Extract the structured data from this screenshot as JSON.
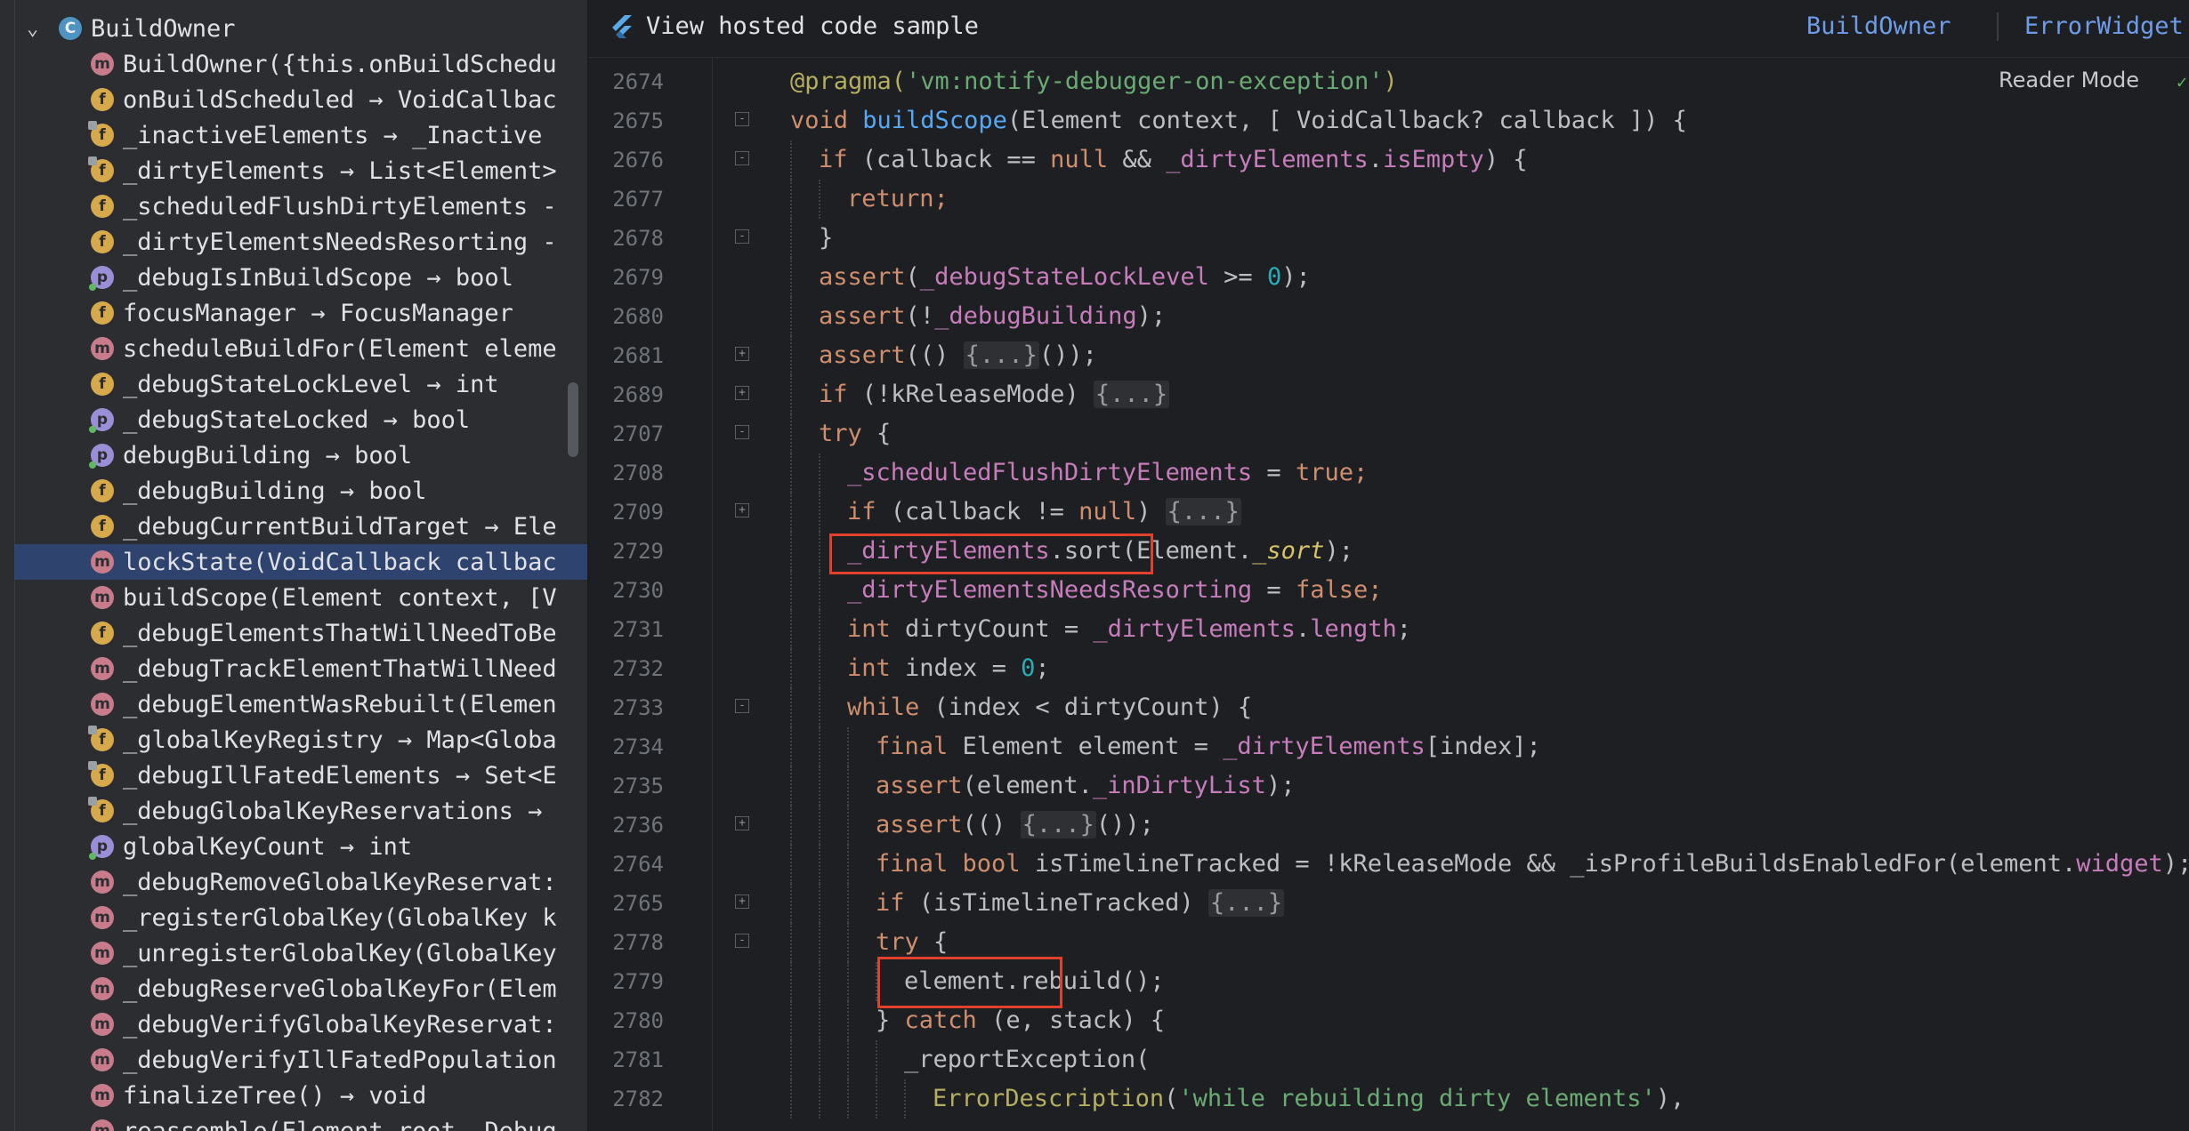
{
  "structure": {
    "root": {
      "label": "BuildOwner",
      "badge": "c"
    },
    "items": [
      {
        "label": "BuildOwner({this.onBuildSchedu",
        "badge": "m",
        "mod": ""
      },
      {
        "label": "onBuildScheduled → VoidCallbac",
        "badge": "f",
        "mod": ""
      },
      {
        "label": "_inactiveElements → _Inactive",
        "badge": "f",
        "mod": "lock"
      },
      {
        "label": "_dirtyElements → List<Element>",
        "badge": "f",
        "mod": "lock"
      },
      {
        "label": "_scheduledFlushDirtyElements -",
        "badge": "f",
        "mod": ""
      },
      {
        "label": "_dirtyElementsNeedsResorting -",
        "badge": "f",
        "mod": ""
      },
      {
        "label": "_debugIsInBuildScope → bool",
        "badge": "p",
        "mod": "pub"
      },
      {
        "label": "focusManager → FocusManager",
        "badge": "f",
        "mod": ""
      },
      {
        "label": "scheduleBuildFor(Element eleme",
        "badge": "m",
        "mod": ""
      },
      {
        "label": "_debugStateLockLevel → int",
        "badge": "f",
        "mod": ""
      },
      {
        "label": "_debugStateLocked → bool",
        "badge": "p",
        "mod": "pub"
      },
      {
        "label": "debugBuilding → bool",
        "badge": "p",
        "mod": "pub"
      },
      {
        "label": "_debugBuilding → bool",
        "badge": "f",
        "mod": ""
      },
      {
        "label": "_debugCurrentBuildTarget → Ele",
        "badge": "f",
        "mod": ""
      },
      {
        "label": "lockState(VoidCallback callbac",
        "badge": "m",
        "mod": "",
        "selected": true
      },
      {
        "label": "buildScope(Element context, [V",
        "badge": "m",
        "mod": ""
      },
      {
        "label": "_debugElementsThatWillNeedToBe",
        "badge": "f",
        "mod": ""
      },
      {
        "label": "_debugTrackElementThatWillNeed",
        "badge": "m",
        "mod": ""
      },
      {
        "label": "_debugElementWasRebuilt(Elemen",
        "badge": "m",
        "mod": ""
      },
      {
        "label": "_globalKeyRegistry → Map<Globa",
        "badge": "f",
        "mod": "lock"
      },
      {
        "label": "_debugIllFatedElements → Set<E",
        "badge": "f",
        "mod": "lock"
      },
      {
        "label": "_debugGlobalKeyReservations →",
        "badge": "f",
        "mod": "lock"
      },
      {
        "label": "globalKeyCount → int",
        "badge": "p",
        "mod": "pub"
      },
      {
        "label": "_debugRemoveGlobalKeyReservat:",
        "badge": "m",
        "mod": ""
      },
      {
        "label": "_registerGlobalKey(GlobalKey k",
        "badge": "m",
        "mod": ""
      },
      {
        "label": "_unregisterGlobalKey(GlobalKey",
        "badge": "m",
        "mod": ""
      },
      {
        "label": "_debugReserveGlobalKeyFor(Elem",
        "badge": "m",
        "mod": ""
      },
      {
        "label": "_debugVerifyGlobalKeyReservat:",
        "badge": "m",
        "mod": ""
      },
      {
        "label": "_debugVerifyIllFatedPopulation",
        "badge": "m",
        "mod": ""
      },
      {
        "label": "finalizeTree() → void",
        "badge": "m",
        "mod": ""
      },
      {
        "label": "reassemble(Element root, Debug",
        "badge": "m",
        "mod": ""
      }
    ]
  },
  "editor": {
    "hosted_link": "View hosted code sample",
    "breadcrumb": [
      "BuildOwner",
      "ErrorWidget"
    ],
    "reader_mode": "Reader Mode",
    "lines": [
      {
        "n": "2674",
        "indent": 1,
        "fold": "",
        "html": "<span class='ann'>@pragma(</span><span class='str'>'vm:notify-debugger-on-exception'</span><span class='ann'>)</span>"
      },
      {
        "n": "2675",
        "indent": 1,
        "fold": "-",
        "html": "<span class='kw'>void </span><span class='fn'>buildScope</span>(Element context, [ VoidCallback? callback ]) {"
      },
      {
        "n": "2676",
        "indent": 2,
        "fold": "-",
        "html": "<span class='kw'>if </span>(callback == <span class='kw'>null</span> &amp;&amp; <span class='fld'>_dirtyElements</span>.<span class='fld'>isEmpty</span>) {"
      },
      {
        "n": "2677",
        "indent": 3,
        "fold": "",
        "html": "<span class='kw'>return;</span>"
      },
      {
        "n": "2678",
        "indent": 2,
        "fold": "-",
        "html": "}"
      },
      {
        "n": "2679",
        "indent": 2,
        "fold": "",
        "html": "<span class='kw'>assert</span>(<span class='fld'>_debugStateLockLevel</span> &gt;= <span class='num'>0</span>);"
      },
      {
        "n": "2680",
        "indent": 2,
        "fold": "",
        "html": "<span class='kw'>assert</span>(!<span class='fld'>_debugBuilding</span>);"
      },
      {
        "n": "2681",
        "indent": 2,
        "fold": "+",
        "html": "<span class='kw'>assert</span>(() <span class='fold-text'>{...}</span>());"
      },
      {
        "n": "2689",
        "indent": 2,
        "fold": "+",
        "html": "<span class='kw'>if </span>(!kReleaseMode) <span class='fold-text'>{...}</span>"
      },
      {
        "n": "2707",
        "indent": 2,
        "fold": "-",
        "html": "<span class='kw'>try </span>{"
      },
      {
        "n": "2708",
        "indent": 3,
        "fold": "",
        "html": "<span class='fld'>_scheduledFlushDirtyElements</span> = <span class='kw'>true;</span>"
      },
      {
        "n": "2709",
        "indent": 3,
        "fold": "+",
        "html": "<span class='kw'>if </span>(callback != <span class='kw'>null</span>) <span class='fold-text'>{...}</span>"
      },
      {
        "n": "2729",
        "indent": 3,
        "fold": "",
        "html": "<span class='fld'>_dirtyElements</span>.sort(Element.<span class='it2'>_sort</span>);"
      },
      {
        "n": "2730",
        "indent": 3,
        "fold": "",
        "html": "<span class='fld'>_dirtyElementsNeedsResorting</span> = <span class='kw'>false;</span>"
      },
      {
        "n": "2731",
        "indent": 3,
        "fold": "",
        "html": "<span class='kw'>int </span>dirtyCount = <span class='fld'>_dirtyElements</span>.<span class='fld'>length</span>;"
      },
      {
        "n": "2732",
        "indent": 3,
        "fold": "",
        "html": "<span class='kw'>int </span>index = <span class='num'>0</span>;"
      },
      {
        "n": "2733",
        "indent": 3,
        "fold": "-",
        "html": "<span class='kw'>while </span>(index &lt; dirtyCount) {"
      },
      {
        "n": "2734",
        "indent": 4,
        "fold": "",
        "html": "<span class='kw'>final </span>Element element = <span class='fld'>_dirtyElements</span>[index];"
      },
      {
        "n": "2735",
        "indent": 4,
        "fold": "",
        "html": "<span class='kw'>assert</span>(element.<span class='fld'>_inDirtyList</span>);"
      },
      {
        "n": "2736",
        "indent": 4,
        "fold": "+",
        "html": "<span class='kw'>assert</span>(() <span class='fold-text'>{...}</span>());"
      },
      {
        "n": "2764",
        "indent": 4,
        "fold": "",
        "html": "<span class='kw'>final </span><span class='kw'>bool </span>isTimelineTracked = !kReleaseMode &amp;&amp; _isProfileBuildsEnabledFor(element.<span class='fld'>widget</span>);"
      },
      {
        "n": "2765",
        "indent": 4,
        "fold": "+",
        "html": "<span class='kw'>if </span>(isTimelineTracked) <span class='fold-text'>{...}</span>"
      },
      {
        "n": "2778",
        "indent": 4,
        "fold": "-",
        "html": "<span class='kw'>try </span>{"
      },
      {
        "n": "2779",
        "indent": 5,
        "fold": "",
        "html": "element.rebuild();"
      },
      {
        "n": "2780",
        "indent": 4,
        "fold": "",
        "html": "} <span class='kw'>catch </span>(e, stack) {"
      },
      {
        "n": "2781",
        "indent": 5,
        "fold": "",
        "html": "_reportException("
      },
      {
        "n": "2782",
        "indent": 6,
        "fold": "",
        "html": "<span class='ann'>ErrorDescription</span>(<span class='str'>'while rebuilding dirty elements'</span>),"
      }
    ]
  },
  "colors": {
    "accent": "#6e9ce8",
    "highlight_box": "#e0412c",
    "selection": "#2e436e"
  }
}
